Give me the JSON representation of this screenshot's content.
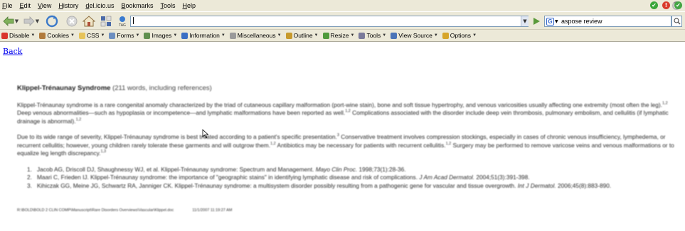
{
  "menu": [
    {
      "label": "File",
      "u": "F",
      "rest": "ile"
    },
    {
      "label": "Edit",
      "u": "E",
      "rest": "dit"
    },
    {
      "label": "View",
      "u": "V",
      "rest": "iew"
    },
    {
      "label": "History",
      "u": "H",
      "rest": "istory"
    },
    {
      "label": "del.icio.us",
      "u": "d",
      "rest": "el.icio.us"
    },
    {
      "label": "Bookmarks",
      "u": "B",
      "rest": "ookmarks"
    },
    {
      "label": "Tools",
      "u": "T",
      "rest": "ools"
    },
    {
      "label": "Help",
      "u": "H",
      "rest": "elp"
    }
  ],
  "navigation": {
    "url_value": "",
    "search_value": "aspose review",
    "tag_label": "TAG"
  },
  "devtoolbar": {
    "items": [
      {
        "label": "Disable",
        "icon": "no-entry-icon",
        "color": "#d9342b"
      },
      {
        "label": "Cookies",
        "icon": "cookie-icon",
        "color": "#b07a3c"
      },
      {
        "label": "CSS",
        "icon": "folder-icon",
        "color": "#e6c35a"
      },
      {
        "label": "Forms",
        "icon": "form-icon",
        "color": "#6d8fc0"
      },
      {
        "label": "Images",
        "icon": "image-icon",
        "color": "#5f8f4e"
      },
      {
        "label": "Information",
        "icon": "info-icon",
        "color": "#3a6fc4"
      },
      {
        "label": "Miscellaneous",
        "icon": "misc-icon",
        "color": "#9a9a9a"
      },
      {
        "label": "Outline",
        "icon": "outline-icon",
        "color": "#c79a2c"
      },
      {
        "label": "Resize",
        "icon": "resize-icon",
        "color": "#4f9a3c"
      },
      {
        "label": "Tools",
        "icon": "wrench-icon",
        "color": "#7a7a9a"
      },
      {
        "label": "View Source",
        "icon": "source-icon",
        "color": "#4a74b8"
      },
      {
        "label": "Options",
        "icon": "options-icon",
        "color": "#d6a42a"
      }
    ],
    "status_colors": {
      "ok": "#3aa63a",
      "error": "#d93a2b",
      "warn": "#44a544"
    }
  },
  "page": {
    "back_link": "Back",
    "doc": {
      "title": "Klippel-Trénaunay Syndrome",
      "word_count": "(211 words, including references)",
      "para1": {
        "a": "Klippel-Trénaunay syndrome is a rare congenital anomaly characterized by the triad of cutaneous capillary malformation (port-wine stain), bone and soft tissue hypertrophy, and venous varicosities usually affecting one extremity (most often the leg).",
        "sup1": "1,2",
        "b": " Deep venous abnormalities—such as hypoplasia or incompetence—and lymphatic malformations have been reported as well.",
        "sup2": "1,2",
        "c": " Complications associated with the disorder include deep vein thrombosis, pulmonary embolism, and cellulitis (if lymphatic drainage is abnormal).",
        "sup3": "1,2"
      },
      "para2": {
        "a": "Due to its wide range of severity, Klippel-Trénaunay syndrome is best treated according to a patient's specific presentation.",
        "sup1": "3",
        "b": " Conservative treatment involves compression stockings, especially in cases of chronic venous insufficiency, lymphedema, or recurrent cellulitis; however, young children rarely tolerate these garments and will outgrow them.",
        "sup2": "1,2",
        "c": " Antibiotics may be necessary for patients with recurrent cellulitis.",
        "sup3": "1,2",
        "d": " Surgery may be performed to remove varicose veins and venous malformations or to equalize leg length discrepancy.",
        "sup4": "1,3"
      },
      "references": [
        {
          "num": "1.",
          "text": "Jacob AG, Driscoll DJ, Shaughnessy WJ, et al. Klippel-Trénaunay syndrome: Spectrum and Management.",
          "journal": "Mayo Clin Proc.",
          "cite": " 1998;73(1):28-36."
        },
        {
          "num": "2.",
          "text": "Maari C, Frieden IJ. Klippel-Trénaunay syndrome: the importance of \"geographic stains\" in identifying lymphatic disease and risk of complications.",
          "journal": "J Am Acad Dermatol.",
          "cite": " 2004;51(3):391-398."
        },
        {
          "num": "3.",
          "text": "Kihiczak GG, Meine JG, Schwartz RA, Janniger CK. Klippel-Trénaunay syndrome: a multisystem disorder possibly resulting from a pathogenic gene for vascular and tissue overgrowth.",
          "journal": "Int J Dermatol.",
          "cite": " 2006;45(8):883-890."
        }
      ],
      "footer_path": "R:\\BOLD\\BOLD 2 CLIN COMP\\Manuscript\\Rare Disorders Overviews\\Vascular\\Klippel.doc",
      "footer_date": "11/1/2007 11:19:27 AM"
    }
  }
}
